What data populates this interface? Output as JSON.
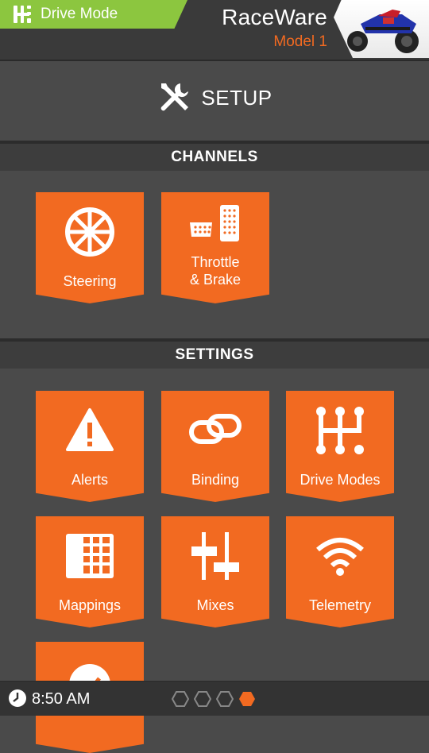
{
  "header": {
    "drive_mode_label": "Drive Mode",
    "app_name": "RaceWare",
    "model_name": "Model 1"
  },
  "page": {
    "title": "SETUP"
  },
  "sections": {
    "channels": "CHANNELS",
    "settings": "SETTINGS"
  },
  "tiles": {
    "steering": "Steering",
    "throttle_line1": "Throttle",
    "throttle_line2": "& Brake",
    "alerts": "Alerts",
    "binding": "Binding",
    "drive_modes": "Drive Modes",
    "mappings": "Mappings",
    "mixes": "Mixes",
    "telemetry": "Telemetry"
  },
  "status": {
    "time": "8:50 AM",
    "page_count": 4,
    "active_page": 4
  },
  "colors": {
    "accent_orange": "#f26a21",
    "drive_mode_green": "#8cc63f",
    "background": "#4a4a4a",
    "bar": "#3a3a3a"
  },
  "icons": {
    "drive_mode": "gear-shifter-icon",
    "setup": "wrench-screwdriver-icon",
    "steering": "steering-wheel-icon",
    "throttle": "pedals-icon",
    "alerts": "warning-triangle-icon",
    "binding": "chain-link-icon",
    "drive_modes": "gear-shifter-icon",
    "mappings": "grid-table-icon",
    "mixes": "sliders-icon",
    "telemetry": "wifi-signal-icon",
    "clock": "clock-icon"
  }
}
